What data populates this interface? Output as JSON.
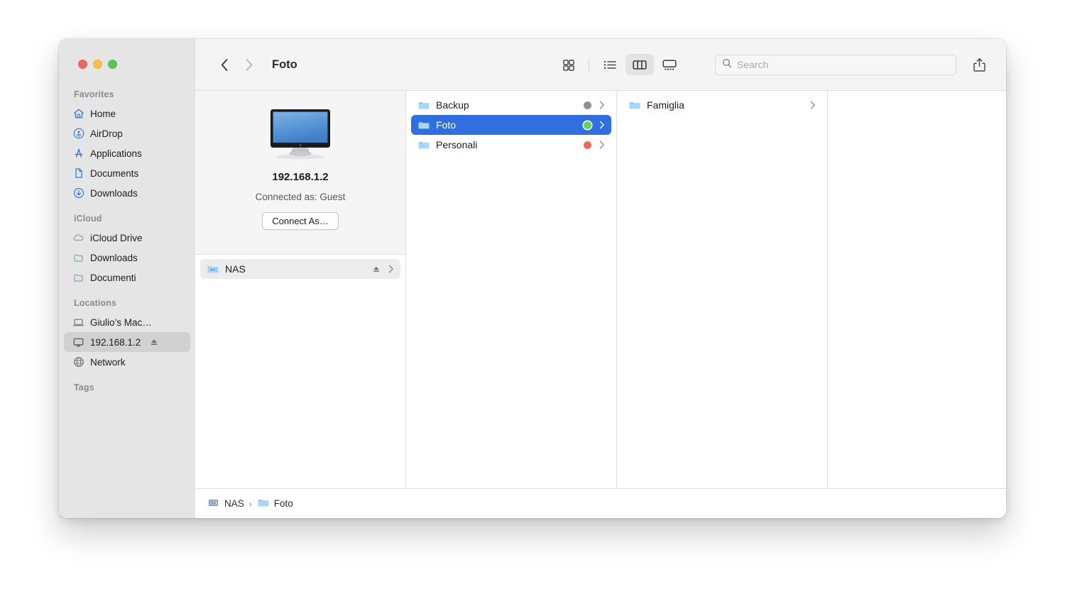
{
  "window": {
    "title": "Foto",
    "traffic_lights": [
      {
        "name": "close",
        "color": "#e8695f"
      },
      {
        "name": "minimize",
        "color": "#f3bf4c"
      },
      {
        "name": "maximize",
        "color": "#5dc354"
      }
    ]
  },
  "toolbar": {
    "back_icon": "chevron-left",
    "forward_icon": "chevron-right",
    "back_enabled": true,
    "forward_enabled": false,
    "view_modes": [
      {
        "name": "icon-view",
        "icon": "grid-icon",
        "active": false
      },
      {
        "name": "list-view",
        "icon": "list-icon",
        "active": false
      },
      {
        "name": "column-view",
        "icon": "columns-icon",
        "active": true
      },
      {
        "name": "gallery-view",
        "icon": "gallery-icon",
        "active": false
      }
    ],
    "search": {
      "placeholder": "Search",
      "value": "",
      "icon": "search-icon"
    },
    "share_icon": "share-icon"
  },
  "sidebar": {
    "groups": [
      {
        "title": "Favorites",
        "items": [
          {
            "label": "Home",
            "icon": "house-icon",
            "selected": false
          },
          {
            "label": "AirDrop",
            "icon": "airdrop-icon",
            "selected": false
          },
          {
            "label": "Applications",
            "icon": "applications-icon",
            "selected": false
          },
          {
            "label": "Documents",
            "icon": "document-icon",
            "selected": false
          },
          {
            "label": "Downloads",
            "icon": "download-icon",
            "selected": false
          }
        ]
      },
      {
        "title": "iCloud",
        "items": [
          {
            "label": "iCloud Drive",
            "icon": "cloud-icon",
            "selected": false
          },
          {
            "label": "Downloads",
            "icon": "folder-icon",
            "selected": false
          },
          {
            "label": "Documenti",
            "icon": "folder-icon",
            "selected": false
          }
        ]
      },
      {
        "title": "Locations",
        "items": [
          {
            "label": "Giulio’s Mac…",
            "icon": "laptop-icon",
            "selected": false
          },
          {
            "label": "192.168.1.2",
            "icon": "display-icon",
            "selected": true,
            "eject": true
          },
          {
            "label": "Network",
            "icon": "globe-icon",
            "selected": false
          }
        ]
      },
      {
        "title": "Tags",
        "items": []
      }
    ]
  },
  "preview": {
    "icon": "display-icon",
    "server_name": "192.168.1.2",
    "status": "Connected as: Guest",
    "connect_button": "Connect As…"
  },
  "volumes": [
    {
      "label": "NAS",
      "icon": "nas-folder-icon",
      "eject": true,
      "chevron": true,
      "selected": true
    }
  ],
  "folder_column": [
    {
      "label": "Backup",
      "icon": "folder-icon",
      "tag_color": "#8e8e93",
      "selected": false,
      "chevron": true
    },
    {
      "label": "Foto",
      "icon": "folder-icon",
      "tag_color": "#63d063",
      "selected": true,
      "chevron": true
    },
    {
      "label": "Personali",
      "icon": "folder-icon",
      "tag_color": "#ed6a5a",
      "selected": false,
      "chevron": true
    }
  ],
  "subfolder_column": [
    {
      "label": "Famiglia",
      "icon": "folder-icon",
      "tag_color": null,
      "selected": false,
      "chevron": true
    }
  ],
  "pathbar": {
    "segments": [
      {
        "label": "NAS",
        "icon": "nas-drive-icon"
      },
      {
        "label": "Foto",
        "icon": "folder-icon"
      }
    ],
    "separator": "›"
  }
}
